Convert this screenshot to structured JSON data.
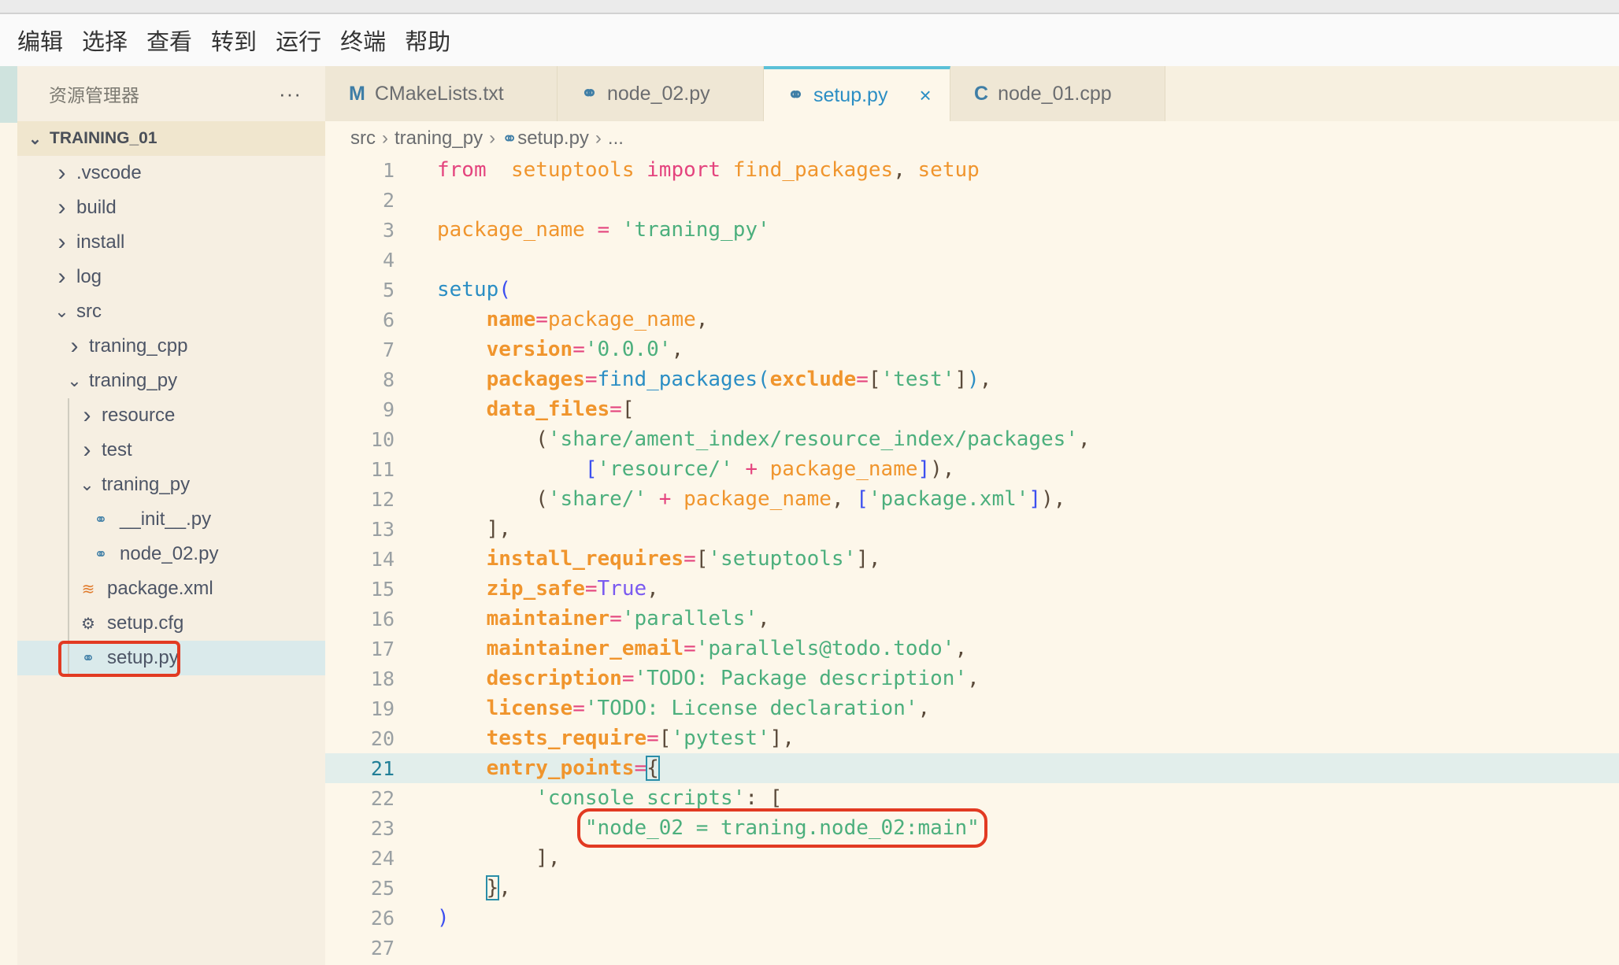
{
  "menu": [
    "编辑",
    "选择",
    "查看",
    "转到",
    "运行",
    "终端",
    "帮助"
  ],
  "sidebar": {
    "title": "资源管理器",
    "more": "···",
    "root": "TRAINING_01",
    "items": [
      {
        "label": ".vscode",
        "level": 0,
        "type": "folder",
        "open": false
      },
      {
        "label": "build",
        "level": 0,
        "type": "folder",
        "open": false
      },
      {
        "label": "install",
        "level": 0,
        "type": "folder",
        "open": false
      },
      {
        "label": "log",
        "level": 0,
        "type": "folder",
        "open": false
      },
      {
        "label": "src",
        "level": 0,
        "type": "folder",
        "open": true
      },
      {
        "label": "traning_cpp",
        "level": 1,
        "type": "folder",
        "open": false
      },
      {
        "label": "traning_py",
        "level": 1,
        "type": "folder",
        "open": true
      },
      {
        "label": "resource",
        "level": 2,
        "type": "folder",
        "open": false
      },
      {
        "label": "test",
        "level": 2,
        "type": "folder",
        "open": false
      },
      {
        "label": "traning_py",
        "level": 2,
        "type": "folder",
        "open": true
      },
      {
        "label": "__init__.py",
        "level": 3,
        "type": "python"
      },
      {
        "label": "node_02.py",
        "level": 3,
        "type": "python"
      },
      {
        "label": "package.xml",
        "level": 2,
        "type": "rss"
      },
      {
        "label": "setup.cfg",
        "level": 2,
        "type": "gear"
      },
      {
        "label": "setup.py",
        "level": 2,
        "type": "python",
        "selected": true
      }
    ]
  },
  "tabs": [
    {
      "label": "CMakeLists.txt",
      "icon": "M",
      "icon_name": "cmake-icon"
    },
    {
      "label": "node_02.py",
      "icon": "⚭",
      "icon_name": "python-icon"
    },
    {
      "label": "setup.py",
      "icon": "⚭",
      "icon_name": "python-icon",
      "active": true,
      "close": "×"
    },
    {
      "label": "node_01.cpp",
      "icon": "C",
      "icon_name": "cpp-icon"
    }
  ],
  "breadcrumb": [
    "src",
    "traning_py",
    "setup.py",
    "..."
  ],
  "editor": {
    "current_line": 21,
    "lines": [
      [
        [
          "k",
          "from"
        ],
        [
          "",
          "  "
        ],
        [
          "v",
          "setuptools"
        ],
        [
          "",
          " "
        ],
        [
          "k",
          "import"
        ],
        [
          "",
          " "
        ],
        [
          "v",
          "find_packages"
        ],
        [
          "d",
          ", "
        ],
        [
          "v",
          "setup"
        ]
      ],
      [],
      [
        [
          "v",
          "package_name"
        ],
        [
          "",
          " "
        ],
        [
          "k",
          "="
        ],
        [
          "",
          " "
        ],
        [
          "s",
          "'traning_py'"
        ]
      ],
      [],
      [
        [
          "f",
          "setup"
        ],
        [
          "b",
          "("
        ]
      ],
      [
        [
          "",
          "    "
        ],
        [
          "p",
          "name"
        ],
        [
          "k",
          "="
        ],
        [
          "v",
          "package_name"
        ],
        [
          "d",
          ","
        ]
      ],
      [
        [
          "",
          "    "
        ],
        [
          "p",
          "version"
        ],
        [
          "k",
          "="
        ],
        [
          "s",
          "'0.0.0'"
        ],
        [
          "d",
          ","
        ]
      ],
      [
        [
          "",
          "    "
        ],
        [
          "p",
          "packages"
        ],
        [
          "k",
          "="
        ],
        [
          "f",
          "find_packages("
        ],
        [
          "p",
          "exclude"
        ],
        [
          "k",
          "="
        ],
        [
          "d",
          "["
        ],
        [
          "s",
          "'test'"
        ],
        [
          "d",
          "]"
        ],
        [
          "f",
          ")"
        ],
        [
          "d",
          ","
        ]
      ],
      [
        [
          "",
          "    "
        ],
        [
          "p",
          "data_files"
        ],
        [
          "k",
          "="
        ],
        [
          "d",
          "["
        ]
      ],
      [
        [
          "",
          "        "
        ],
        [
          "d",
          "("
        ],
        [
          "s",
          "'share/ament_index/resource_index/packages'"
        ],
        [
          "d",
          ","
        ]
      ],
      [
        [
          "",
          "            "
        ],
        [
          "b",
          "["
        ],
        [
          "s",
          "'resource/'"
        ],
        [
          "",
          " "
        ],
        [
          "k",
          "+"
        ],
        [
          "",
          " "
        ],
        [
          "v",
          "package_name"
        ],
        [
          "b",
          "]"
        ],
        [
          "d",
          "),"
        ]
      ],
      [
        [
          "",
          "        "
        ],
        [
          "d",
          "("
        ],
        [
          "s",
          "'share/'"
        ],
        [
          "",
          " "
        ],
        [
          "k",
          "+"
        ],
        [
          "",
          " "
        ],
        [
          "v",
          "package_name"
        ],
        [
          "d",
          ", "
        ],
        [
          "b",
          "["
        ],
        [
          "s",
          "'package.xml'"
        ],
        [
          "b",
          "]"
        ],
        [
          "d",
          "),"
        ]
      ],
      [
        [
          "",
          "    "
        ],
        [
          "d",
          "],"
        ]
      ],
      [
        [
          "",
          "    "
        ],
        [
          "p",
          "install_requires"
        ],
        [
          "k",
          "="
        ],
        [
          "d",
          "["
        ],
        [
          "s",
          "'setuptools'"
        ],
        [
          "d",
          "],"
        ]
      ],
      [
        [
          "",
          "    "
        ],
        [
          "p",
          "zip_safe"
        ],
        [
          "k",
          "="
        ],
        [
          "c",
          "True"
        ],
        [
          "d",
          ","
        ]
      ],
      [
        [
          "",
          "    "
        ],
        [
          "p",
          "maintainer"
        ],
        [
          "k",
          "="
        ],
        [
          "s",
          "'parallels'"
        ],
        [
          "d",
          ","
        ]
      ],
      [
        [
          "",
          "    "
        ],
        [
          "p",
          "maintainer_email"
        ],
        [
          "k",
          "="
        ],
        [
          "s",
          "'parallels@todo.todo'"
        ],
        [
          "d",
          ","
        ]
      ],
      [
        [
          "",
          "    "
        ],
        [
          "p",
          "description"
        ],
        [
          "k",
          "="
        ],
        [
          "s",
          "'TODO: Package description'"
        ],
        [
          "d",
          ","
        ]
      ],
      [
        [
          "",
          "    "
        ],
        [
          "p",
          "license"
        ],
        [
          "k",
          "="
        ],
        [
          "s",
          "'TODO: License declaration'"
        ],
        [
          "d",
          ","
        ]
      ],
      [
        [
          "",
          "    "
        ],
        [
          "p",
          "tests_require"
        ],
        [
          "k",
          "="
        ],
        [
          "d",
          "["
        ],
        [
          "s",
          "'pytest'"
        ],
        [
          "d",
          "],"
        ]
      ],
      [
        [
          "",
          "    "
        ],
        [
          "p",
          "entry_points"
        ],
        [
          "k",
          "="
        ],
        [
          "d match",
          "{"
        ]
      ],
      [
        [
          "",
          "        "
        ],
        [
          "s",
          "'console_scripts'"
        ],
        [
          "d",
          ": ["
        ]
      ],
      [
        [
          "",
          "            "
        ],
        [
          "s redbox",
          "\"node_02 = traning.node_02:main\""
        ]
      ],
      [
        [
          "",
          "        "
        ],
        [
          "d",
          "],"
        ]
      ],
      [
        [
          "",
          "    "
        ],
        [
          "d match",
          "}"
        ],
        [
          "d",
          ","
        ]
      ],
      [
        [
          "b",
          ")"
        ]
      ],
      []
    ]
  },
  "colors": {
    "accent": "#5ac0d8",
    "highlight_box": "#e23a22",
    "keyword": "#e4447e",
    "string": "#4caf7d"
  }
}
